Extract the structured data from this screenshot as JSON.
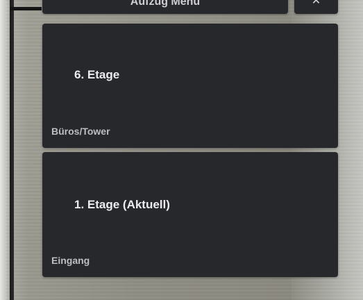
{
  "header": {
    "title": "Aufzug Menu",
    "close_symbol": "✕"
  },
  "floors": [
    {
      "label": "6. Etage",
      "description": "Büros/Tower"
    },
    {
      "label": "1. Etage (Aktuell)",
      "description": "Eingang"
    }
  ],
  "colors": {
    "card_bg": "#27282c",
    "text_primary": "#ececef",
    "text_secondary": "#bdbdc2"
  },
  "icons": {
    "close": "close-icon"
  }
}
